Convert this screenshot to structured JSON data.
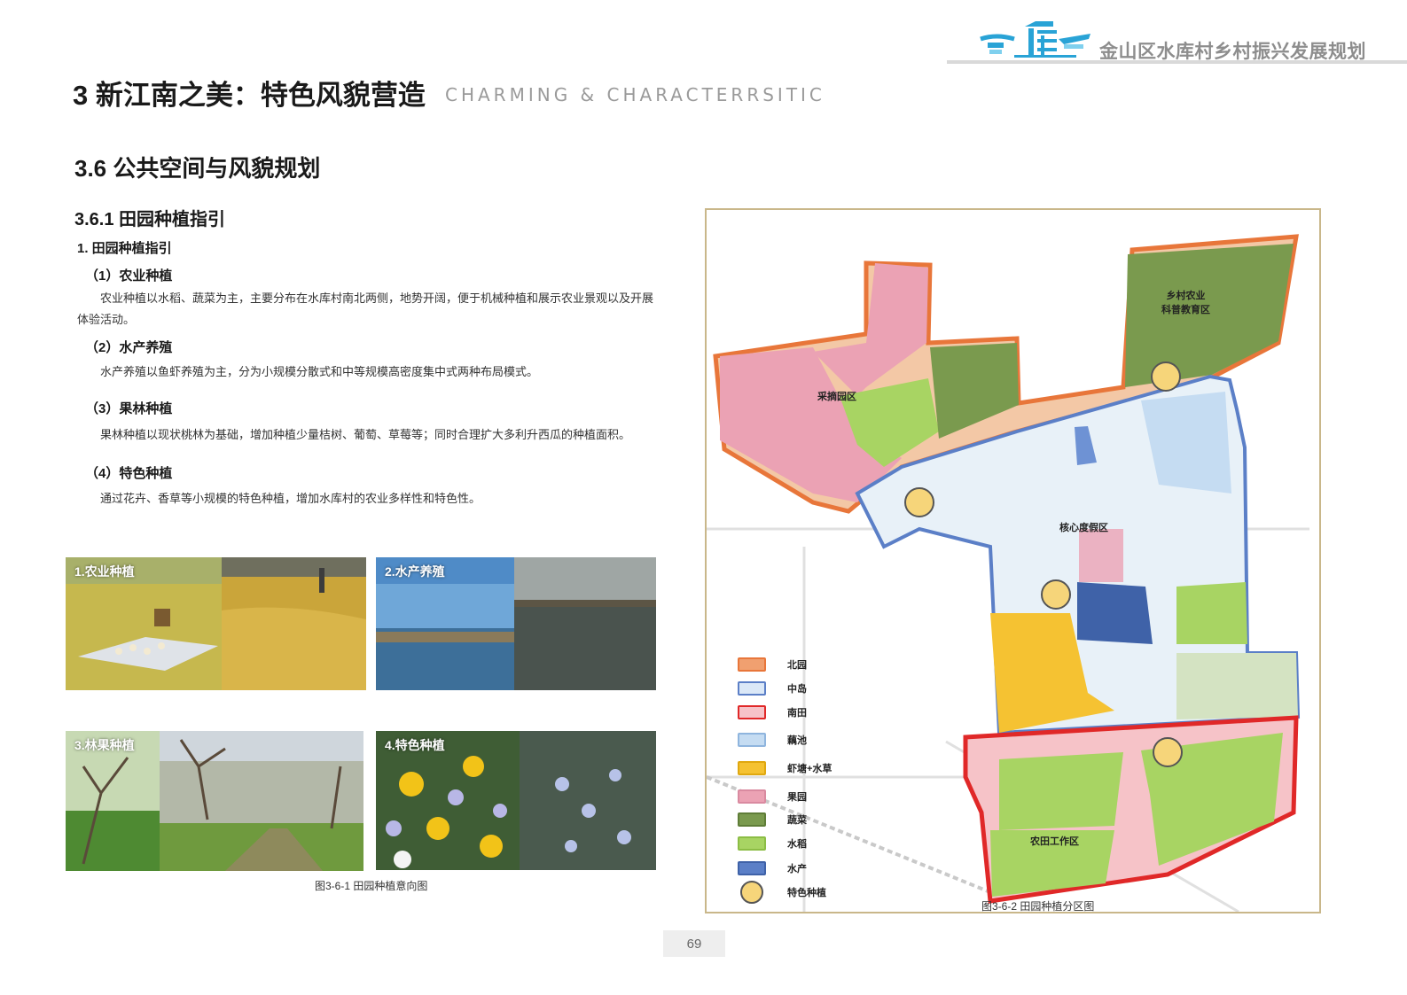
{
  "header": {
    "title": "金山区水库村乡村振兴发展规划",
    "logo_icon": "water-village-logo-icon",
    "logo_color": "#29a3d6"
  },
  "chapter": {
    "title": "3 新江南之美：特色风貌营造",
    "subtitle": "CHARMING & CHARACTERRSITIC"
  },
  "section": {
    "title": "3.6 公共空间与风貌规划",
    "subsection_title": "3.6.1 田园种植指引",
    "guide_title": "1. 田园种植指引",
    "items": [
      {
        "heading": "（1）农业种植",
        "body": "农业种植以水稻、蔬菜为主，主要分布在水库村南北两侧，地势开阔，便于机械种植和展示农业景观以及开展体验活动。"
      },
      {
        "heading": "（2）水产养殖",
        "body": "水产养殖以鱼虾养殖为主，分为小规模分散式和中等规模高密度集中式两种布局模式。"
      },
      {
        "heading": "（3）果林种植",
        "body": "果林种植以现状桃林为基础，增加种植少量桔树、葡萄、草莓等；同时合理扩大多利升西瓜的种植面积。"
      },
      {
        "heading": "（4）特色种植",
        "body": "通过花卉、香草等小规模的特色种植，增加水库村的农业多样性和特色性。"
      }
    ]
  },
  "photos": [
    {
      "label": "1.农业种植"
    },
    {
      "label": "2.水产养殖"
    },
    {
      "label": "3.林果种植"
    },
    {
      "label": "4.特色种植"
    }
  ],
  "figure1_caption": "图3-6-1 田园种植意向图",
  "map": {
    "caption": "图3-6-2 田园种植分区图",
    "zone_labels": {
      "picking": "采摘园区",
      "education_line1": "乡村农业",
      "education_line2": "科普教育区",
      "resort": "核心度假区",
      "farmland": "农田工作区"
    },
    "legend": [
      {
        "label": "北园",
        "color": "#f0a070",
        "border": "#e8763a"
      },
      {
        "label": "中岛",
        "color": "#dbe8f7",
        "border": "#5b7fc7"
      },
      {
        "label": "南田",
        "color": "#f6c3c8",
        "border": "#e02828"
      },
      {
        "label": "藕池",
        "color": "#c5dcf2",
        "border": "#8fb5de"
      },
      {
        "label": "虾塘+水草",
        "color": "#f5c232",
        "border": "#e0a810"
      },
      {
        "label": "果园",
        "color": "#eba2b4",
        "border": "#d98aa0"
      },
      {
        "label": "蔬菜",
        "color": "#7a9a4e",
        "border": "#5f7d38"
      },
      {
        "label": "水稻",
        "color": "#a8d463",
        "border": "#8cbd45"
      },
      {
        "label": "水产",
        "color": "#5b7fc7",
        "border": "#3f62a8"
      },
      {
        "label": "特色种植",
        "color": "#f6d57a",
        "border": "#555555"
      }
    ]
  },
  "page_number": "69"
}
